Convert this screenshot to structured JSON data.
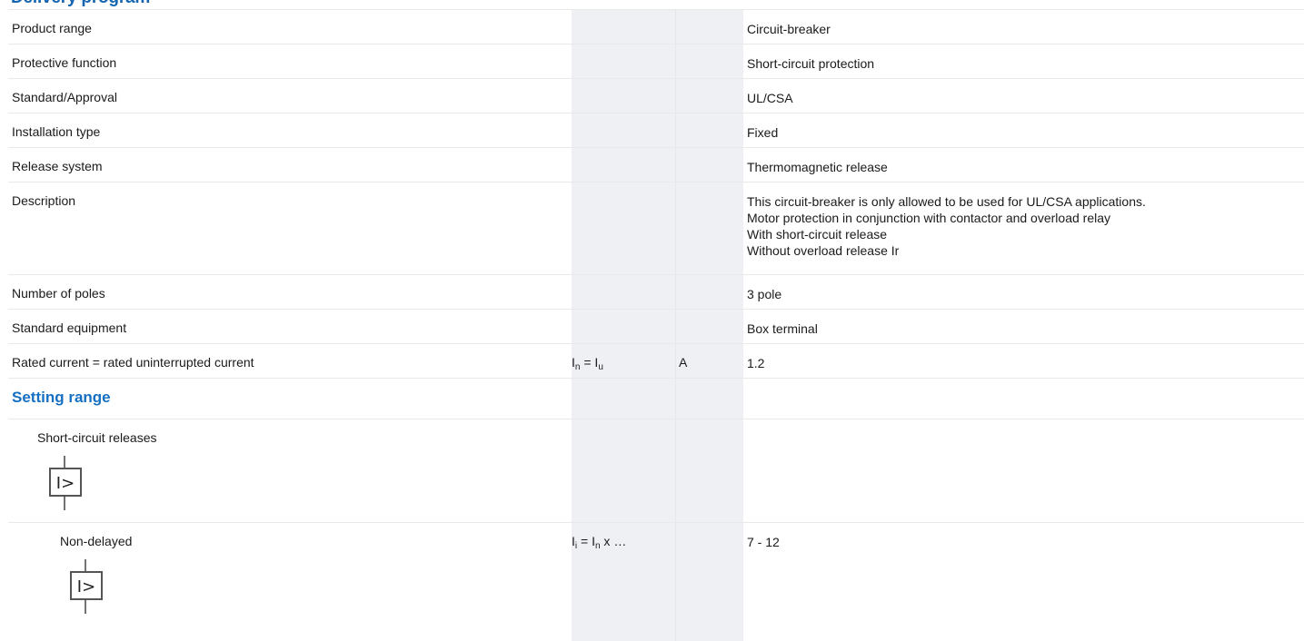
{
  "heading": "Delivery program",
  "rows": [
    {
      "label": "Product range",
      "value": "Circuit-breaker"
    },
    {
      "label": "Protective function",
      "value": "Short-circuit protection"
    },
    {
      "label": "Standard/Approval",
      "value": "UL/CSA"
    },
    {
      "label": "Installation type",
      "value": "Fixed"
    },
    {
      "label": "Release system",
      "value": "Thermomagnetic release"
    }
  ],
  "description": {
    "label": "Description",
    "lines": [
      "This circuit-breaker is only allowed to be used for UL/CSA applications.",
      "Motor protection in conjunction with contactor and overload relay",
      "With short-circuit release",
      "Without overload release Ir"
    ]
  },
  "rows2": [
    {
      "label": "Number of poles",
      "value": "3 pole"
    },
    {
      "label": "Standard equipment",
      "value": "Box terminal"
    }
  ],
  "rated": {
    "label": "Rated current = rated uninterrupted current",
    "sym_a": "I",
    "sym_a_sub": "n",
    "sym_eq": " = ",
    "sym_b": "I",
    "sym_b_sub": "u",
    "unit": "A",
    "value": "1.2"
  },
  "section": {
    "title": "Setting range"
  },
  "short_circuit": {
    "label": "Short-circuit releases",
    "icon": "instantaneous-overcurrent-release-icon",
    "icon_text": "I>"
  },
  "non_delayed": {
    "label": "Non-delayed",
    "sym_a": "I",
    "sym_a_sub": "i",
    "sym_eq": " = ",
    "sym_b": "I",
    "sym_b_sub": "n",
    "sym_rest": " x …",
    "value": "7 - 12",
    "icon": "instantaneous-overcurrent-release-icon",
    "icon_text": "I>"
  }
}
